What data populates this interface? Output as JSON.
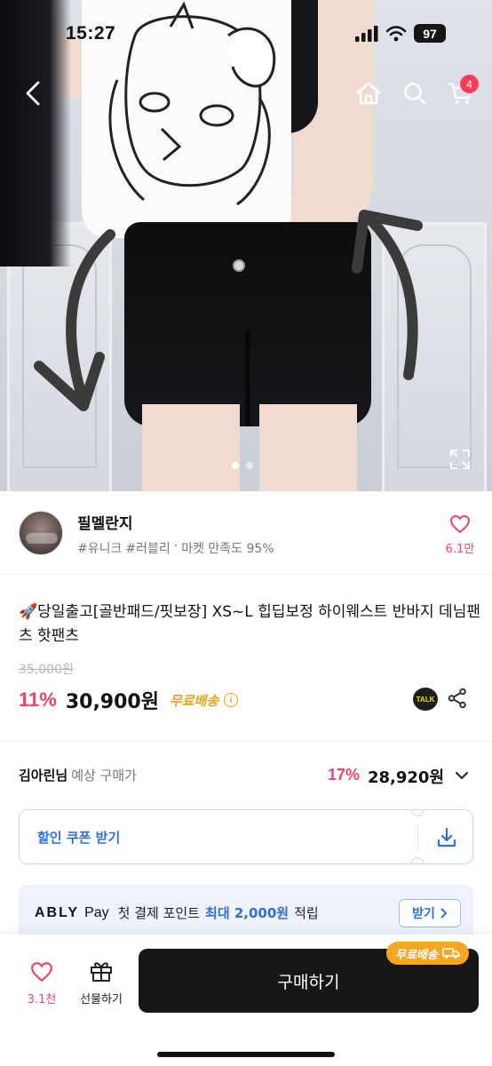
{
  "status_bar": {
    "time": "15:27",
    "battery": "97"
  },
  "header": {
    "cart_count": "4"
  },
  "seller": {
    "name": "필멜란지",
    "tags": [
      "#유니크",
      "#러블리",
      "·",
      "마켓 만족도 95%"
    ],
    "likes": "6.1만"
  },
  "product": {
    "title": "🚀당일출고[골반패드/핏보장] XS~L 힙딥보정 하이웨스트 반바지 데님팬츠 핫팬츠",
    "original_price": "35,000원",
    "discount": "11%",
    "price": "30,900원",
    "free_shipping": "무료배송",
    "talk_label": "TALK"
  },
  "member": {
    "name": "김아린님",
    "label": "예상 구매가",
    "discount": "17%",
    "price": "28,920원"
  },
  "coupon": {
    "label": "할인 쿠폰 받기"
  },
  "ably_pay": {
    "logo": "ABLY",
    "pay": "Pay",
    "text_before": "첫 결제 포인트",
    "highlight": "최대 2,000원",
    "text_after": "적립",
    "button": "받기"
  },
  "bottom_bar": {
    "likes": "3.1천",
    "gift_label": "선물하기",
    "buy_label": "구매하기",
    "ship_tag": "무료배송"
  },
  "colors": {
    "accent": "#ef4466",
    "blue": "#2e6fd8",
    "ship": "#f5a623",
    "buy": "#17171a"
  }
}
